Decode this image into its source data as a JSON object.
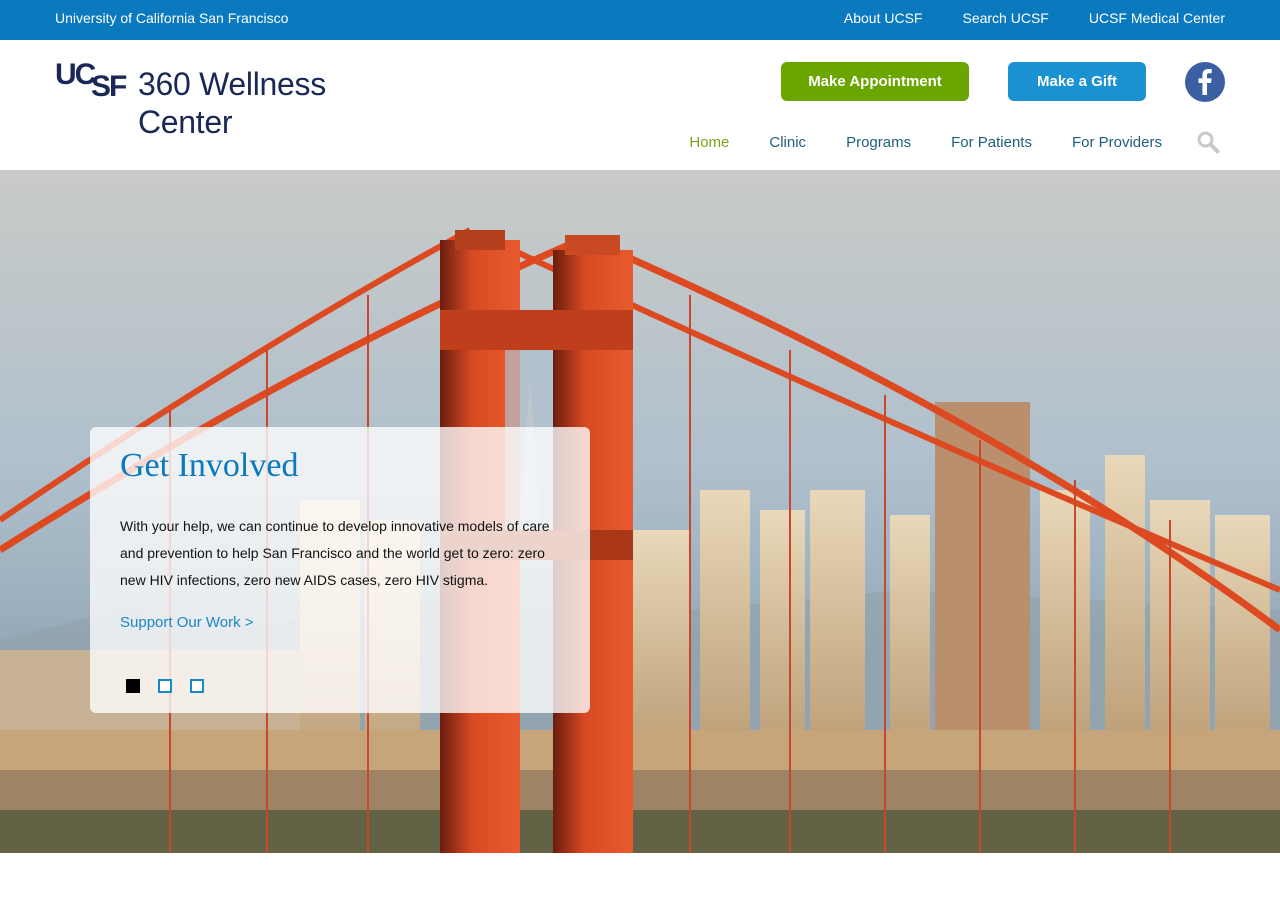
{
  "topbar": {
    "university": "University of California San Francisco",
    "links": [
      "About UCSF",
      "Search UCSF",
      "UCSF Medical Center"
    ]
  },
  "logo": {
    "mark": "UCSF",
    "line1": "360 Wellness",
    "line2": "Center"
  },
  "header": {
    "appointment_label": "Make Appointment",
    "gift_label": "Make a Gift",
    "facebook_icon": "facebook-icon"
  },
  "nav": {
    "items": [
      "Home",
      "Clinic",
      "Programs",
      "For Patients",
      "For Providers"
    ],
    "active": "Home",
    "search_icon": "search-icon"
  },
  "hero": {
    "title": "Get Involved",
    "body": "With your help, we can continue to develop innovative models of care and prevention to help San Francisco and the world get to zero: zero new HIV infections, zero new AIDS cases, zero HIV stigma.",
    "cta": "Support Our Work >",
    "slide_count": 3,
    "active_slide": 1
  },
  "colors": {
    "topbar": "#0a79be",
    "appointment": "#6aa500",
    "gift": "#1a91d0",
    "nav_active": "#7aa41b",
    "nav": "#1f5f7d",
    "brand_navy": "#1a2855"
  }
}
